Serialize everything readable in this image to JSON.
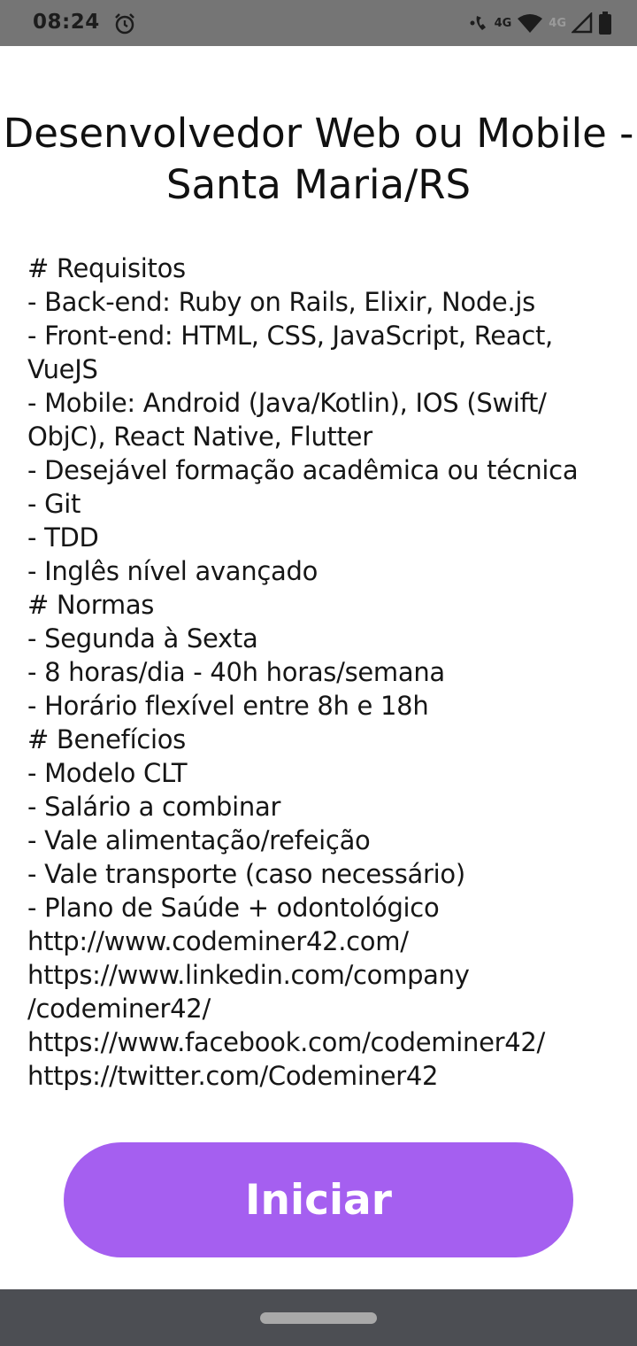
{
  "status_bar": {
    "time": "08:24",
    "network_1": "4G",
    "network_2": "4G",
    "icons": [
      "alarm-icon",
      "wifi-calling-icon",
      "wifi-icon",
      "signal-icon",
      "battery-icon"
    ]
  },
  "title": {
    "line1": "Desenvolvedor Web ou Mobile -",
    "line2": "Santa Maria/RS"
  },
  "description_lines": [
    "# Requisitos",
    "- Back-end: Ruby on Rails, Elixir, Node.js",
    "- Front-end: HTML, CSS, JavaScript, React,",
    "VueJS",
    "- Mobile: Android (Java/Kotlin), IOS (Swift/",
    "ObjC), React Native, Flutter",
    "- Desejável formação acadêmica ou técnica",
    "- Git",
    "- TDD",
    "- Inglês nível avançado",
    "# Normas",
    "- Segunda à Sexta",
    "- 8 horas/dia - 40h horas/semana",
    "- Horário flexível entre 8h e 18h",
    "# Benefícios",
    "- Modelo CLT",
    "- Salário a combinar",
    "- Vale alimentação/refeição",
    "- Vale transporte (caso necessário)",
    "- Plano de Saúde + odontológico",
    "http://www.codeminer42.com/",
    "https://www.linkedin.com/company",
    "/codeminer42/",
    "https://www.facebook.com/codeminer42/",
    "https://twitter.com/Codeminer42"
  ],
  "start_button": {
    "label": "Iniciar"
  },
  "colors": {
    "accent": "#a55ff0",
    "status_bar": "#757575",
    "nav_bar": "#4c4e53"
  }
}
